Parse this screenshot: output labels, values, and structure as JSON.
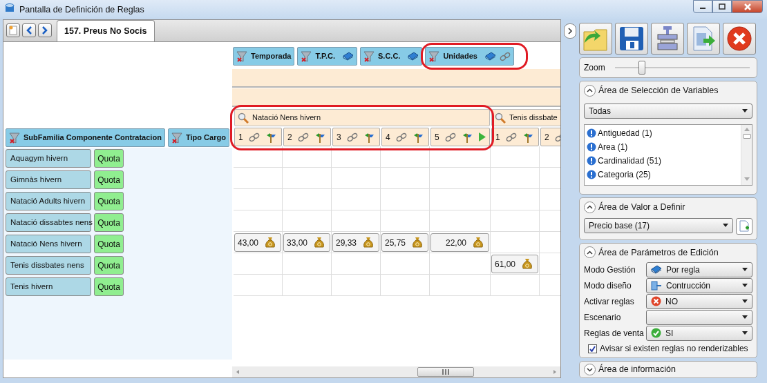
{
  "window": {
    "title": "Pantalla de Definición de Reglas"
  },
  "tab": {
    "label": "157. Preus No Socis",
    "selected": true
  },
  "column_dimensions": [
    {
      "label": "Temporada"
    },
    {
      "label": "T.P.C.",
      "book": true
    },
    {
      "label": "S.C.C.",
      "book": true
    },
    {
      "label": "Unidades",
      "book": true,
      "link": true,
      "highlighted": true
    }
  ],
  "row_dimensions": [
    {
      "label": "SubFamilia Componente Contratacion"
    },
    {
      "label": "Tipo Cargo"
    }
  ],
  "column_groups": [
    {
      "label": "Natació Nens hivern",
      "highlighted": true,
      "columns": [
        {
          "label": "1",
          "has_next": false
        },
        {
          "label": "2",
          "has_next": false
        },
        {
          "label": "3",
          "has_next": false
        },
        {
          "label": "4",
          "has_next": false
        },
        {
          "label": "5",
          "has_next": true
        }
      ]
    },
    {
      "label": "Tenis dissbate",
      "columns": [
        {
          "label": "1",
          "has_next": false
        },
        {
          "label": "2",
          "has_next": false
        }
      ]
    }
  ],
  "rows": [
    {
      "name": "Aquagym hivern",
      "type": "Quota"
    },
    {
      "name": "Gimnàs hivern",
      "type": "Quota"
    },
    {
      "name": "Natació Adults hivern",
      "type": "Quota"
    },
    {
      "name": "Natació dissabtes nens",
      "type": "Quota"
    },
    {
      "name": "Natació Nens hivern",
      "type": "Quota",
      "values": [
        {
          "kind": "price",
          "value": "43,00"
        },
        {
          "kind": "price",
          "value": "33,00"
        },
        {
          "kind": "price",
          "value": "29,33"
        },
        {
          "kind": "price",
          "value": "25,75"
        },
        {
          "kind": "price",
          "value": "22,00"
        }
      ]
    },
    {
      "name": "Tenis dissbates nens",
      "type": "Quota",
      "values": [
        {
          "kind": "empty"
        },
        {
          "kind": "empty"
        },
        {
          "kind": "empty"
        },
        {
          "kind": "empty"
        },
        {
          "kind": "empty"
        },
        {
          "kind": "price",
          "value": "61,00"
        }
      ]
    },
    {
      "name": "Tenis hivern",
      "type": "Quota"
    }
  ],
  "zoom": {
    "label": "Zoom",
    "level": 0.2
  },
  "variables_section": {
    "title": "Área de Selección de Variables",
    "expanded": true,
    "filter": "Todas",
    "items": [
      "Antiguedad (1)",
      "Area (1)",
      "Cardinalidad (51)",
      "Categoria (25)"
    ]
  },
  "value_section": {
    "title": "Área de Valor a Definir",
    "expanded": true,
    "value": "Precio base (17)"
  },
  "params_section": {
    "title": "Área de Parámetros de Edición",
    "expanded": true,
    "fields": [
      {
        "label": "Modo Gestión",
        "value": "Por regla",
        "kind": "book"
      },
      {
        "label": "Modo diseño",
        "value": "Contrucción",
        "kind": "design"
      },
      {
        "label": "Activar reglas",
        "value": "NO",
        "kind": "no"
      },
      {
        "label": "Escenario",
        "kind": "empty"
      },
      {
        "label": "Reglas de venta",
        "value": "SI",
        "kind": "yes"
      }
    ],
    "checkbox": {
      "label": "Avisar si existen reglas no renderizables",
      "checked": true
    }
  },
  "info_section": {
    "title": "Área de información",
    "expanded": false
  }
}
